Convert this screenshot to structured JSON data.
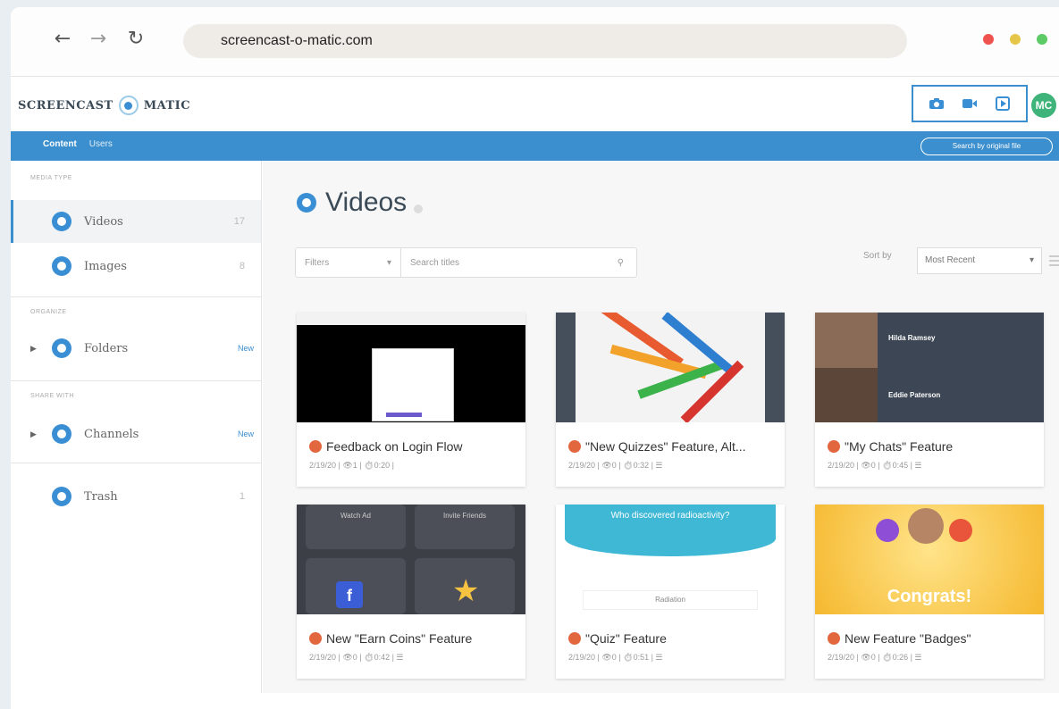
{
  "browser": {
    "url": "screencast-o-matic.com",
    "nav": {
      "back": "←",
      "forward": "→",
      "reload": "↻"
    },
    "window_dots": [
      "#ef5350",
      "#e6c648",
      "#5ccb66"
    ]
  },
  "app": {
    "logo_left": "SCREENCAST",
    "logo_right": "MATIC",
    "tools": [
      "camera-icon",
      "video-icon",
      "quiz-icon"
    ],
    "avatar": "MC"
  },
  "top_nav": {
    "tabs": [
      "Content",
      "Users"
    ],
    "search": "Search by original file"
  },
  "sidebar": {
    "sec_media": "MEDIA TYPE",
    "sec_organize": "ORGANIZE",
    "sec_share": "SHARE WITH",
    "items": [
      {
        "label": "Videos",
        "count": "17"
      },
      {
        "label": "Images",
        "count": "8"
      },
      {
        "label": "Folders",
        "badge": "New"
      },
      {
        "label": "Channels",
        "badge": "New"
      },
      {
        "label": "Trash",
        "count": "1"
      }
    ]
  },
  "main": {
    "title": "Videos",
    "filter_label": "Filters",
    "search_placeholder": "Search titles",
    "sort_label": "Sort by",
    "sort_value": "Most Recent"
  },
  "thumb_text": {
    "c3_name1": "Hilda Ramsey",
    "c3_name2": "Eddie Paterson",
    "c4_btn1": "Watch Ad",
    "c4_btn2": "Invite Friends",
    "c5_question": "Who discovered radioactivity?",
    "c5_answer": "Radiation",
    "c6_text": "Congrats!"
  },
  "cards": [
    {
      "title": "Feedback on Login Flow",
      "meta": "2/19/20 | 👁1 | ⏱0:20 |"
    },
    {
      "title": "\"New Quizzes\" Feature, Alt...",
      "meta": "2/19/20 | 👁0 | ⏱0:32 | ☰"
    },
    {
      "title": "\"My Chats\" Feature",
      "meta": "2/19/20 | 👁0 | ⏱0:45 | ☰"
    },
    {
      "title": "New \"Earn Coins\" Feature",
      "meta": "2/19/20 | 👁0 | ⏱0:42 | ☰"
    },
    {
      "title": "\"Quiz\" Feature",
      "meta": "2/19/20 | 👁0 | ⏱0:51 | ☰"
    },
    {
      "title": "New Feature \"Badges\"",
      "meta": "2/19/20 | 👁0 | ⏱0:26 | ☰"
    }
  ]
}
